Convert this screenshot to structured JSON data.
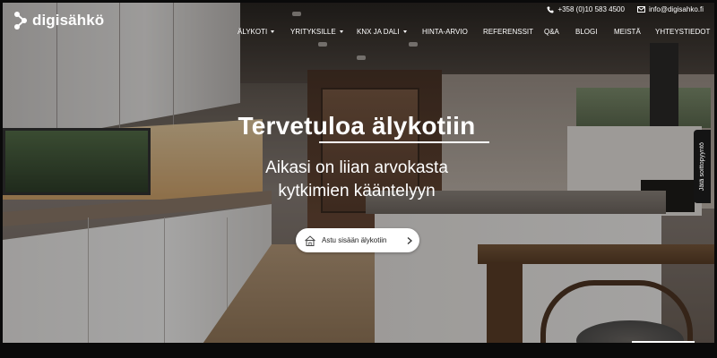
{
  "brand": {
    "name": "digisähkö"
  },
  "contact": {
    "phone": "+358 (0)10 583 4500",
    "email": "info@digisahko.fi"
  },
  "nav": {
    "items": [
      {
        "label": "ÄLYKOTI",
        "has_dropdown": true
      },
      {
        "label": "YRITYKSILLE",
        "has_dropdown": true
      },
      {
        "label": "KNX JA DALI",
        "has_dropdown": true
      },
      {
        "label": "HINTA-ARVIO",
        "has_dropdown": false
      },
      {
        "label": "REFERENSSIT",
        "has_dropdown": false
      },
      {
        "label": "Q&A",
        "has_dropdown": false
      },
      {
        "label": "BLOGI",
        "has_dropdown": false
      },
      {
        "label": "MEISTÄ",
        "has_dropdown": false
      },
      {
        "label": "YHTEYSTIEDOT",
        "has_dropdown": false
      }
    ]
  },
  "hero": {
    "title": "Tervetuloa älykotiin",
    "subtitle_line1": "Aikasi on liian arvokasta",
    "subtitle_line2": "kytkimien kääntelyyn",
    "cta_label": "Astu sisään älykotiin"
  },
  "feedback_tab": {
    "label": "Jätä soittopyyntö"
  },
  "icons": {
    "phone": "phone-icon",
    "email": "envelope-icon",
    "dropdown": "chevron-down-icon",
    "cta": "house-icon",
    "cta_arrow": "chevron-right-icon"
  },
  "colors": {
    "text_on_hero": "#ffffff",
    "button_bg": "#ffffff",
    "button_text": "#222222"
  }
}
